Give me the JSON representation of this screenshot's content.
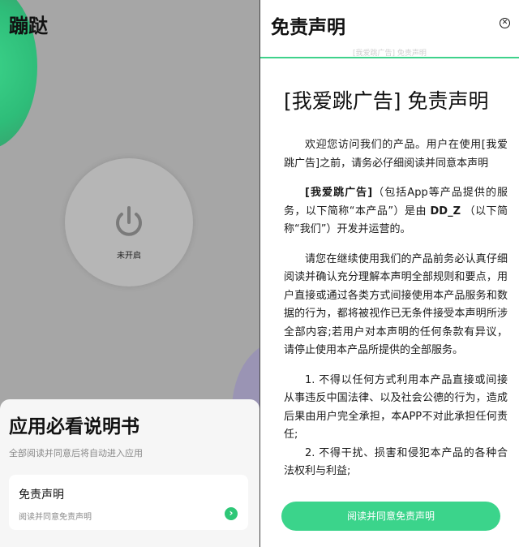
{
  "left": {
    "app_title": "蹦跶",
    "power": {
      "icon": "power-icon",
      "status_label": "未开启"
    },
    "sheet": {
      "title": "应用必看说明书",
      "subtitle": "全部阅读并同意后将自动进入应用",
      "card": {
        "title": "免责声明",
        "subtitle": "阅读并同意免责声明",
        "arrow_icon": "chevron-right-icon"
      }
    }
  },
  "right": {
    "title": "免责声明",
    "close_icon": "close-icon",
    "subtitle": "[我爱跳广告] 免责声明",
    "doc_title": "[我爱跳广告] 免责声明",
    "paragraphs": {
      "p1": "欢迎您访问我们的产品。用户在使用[我爱跳广告]之前，请务必仔细阅读并同意本声明",
      "p2_bold": "[我爱跳广告]",
      "p2_a": "（包括App等产品提供的服务，以下简称“本产品”）是由 ",
      "p2_bold2": "DD_Z",
      "p2_b": " （以下简称“我们”）开发并运营的。",
      "p3": "请您在继续使用我们的产品前务必认真仔细阅读并确认充分理解本声明全部规则和要点，用户直接或通过各类方式间接使用本产品服务和数据的行为，都将被视作已无条件接受本声明所涉全部内容;若用户对本声明的任何条款有异议，请停止使用本产品所提供的全部服务。",
      "p4": "1. 不得以任何方式利用本产品直接或间接从事违反中国法律、以及社会公德的行为，造成后果由用户完全承担，本APP不对此承担任何责任;",
      "p5": "2. 不得干扰、损害和侵犯本产品的各种合法权利与利益;"
    },
    "agree_button": "阅读并同意免责声明"
  },
  "colors": {
    "accent": "#3bd48b",
    "overlay": "#a6a6a6"
  }
}
